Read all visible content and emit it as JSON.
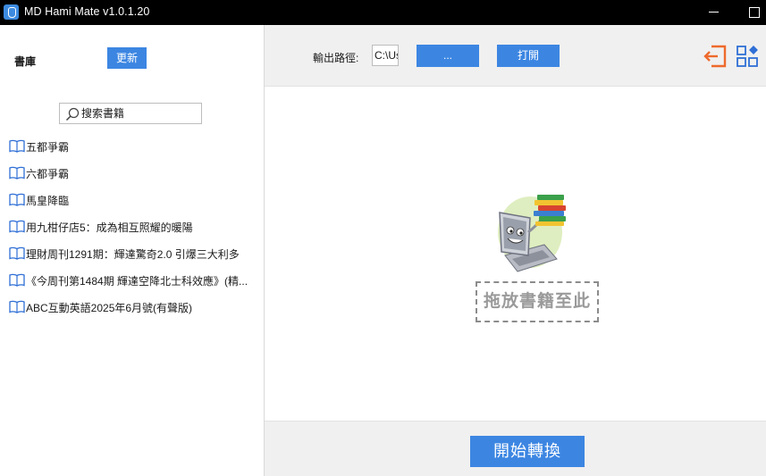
{
  "window": {
    "title": "MD Hami Mate v1.0.1.20",
    "app_icon": "app-logo-icon"
  },
  "library": {
    "label": "書庫",
    "update_label": "更新",
    "search_placeholder": "搜索書籍",
    "books": [
      "五都爭霸",
      "六都爭霸",
      "馬皇降臨",
      "用九柑仔店5：成為相互照耀的暖陽",
      "理財周刊1291期：輝達驚奇2.0 引爆三大利多",
      "《今周刊第1484期 輝達空降北士科效應》(精...",
      "ABC互動英語2025年6月號(有聲版)"
    ]
  },
  "toolbar": {
    "output_label": "輸出路徑:",
    "output_path": "C:\\Us",
    "browse_label": "...",
    "open_label": "打開",
    "exit_icon": "exit-icon",
    "apps_icon": "apps-grid-icon"
  },
  "drop_area": {
    "label": "拖放書籍至此"
  },
  "bottom": {
    "convert_label": "開始轉換"
  },
  "colors": {
    "accent": "#3c86e2",
    "titlebar": "#000000",
    "panel": "#f0f0f0",
    "icon_orange": "#ee6a2c",
    "icon_blue": "#2f6fd6"
  }
}
